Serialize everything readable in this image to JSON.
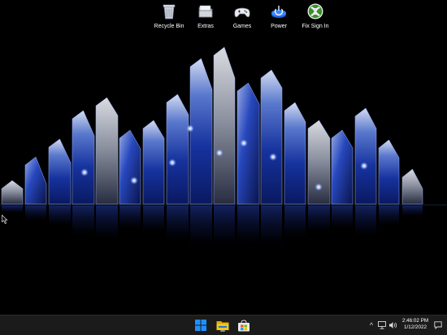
{
  "desktop": {
    "icons": [
      {
        "label": "Recycle Bin",
        "icon": "recycle-bin-icon"
      },
      {
        "label": "Extras",
        "icon": "folder-icon"
      },
      {
        "label": "Games",
        "icon": "gamepad-icon"
      },
      {
        "label": "Power",
        "icon": "power-icon"
      },
      {
        "label": "Fix Sign In",
        "icon": "xbox-icon"
      }
    ],
    "wallpaper": {
      "theme": "blue crystal prisms with reflection",
      "accent": "#1e4fd8"
    }
  },
  "taskbar": {
    "pinned": [
      {
        "name": "start-button",
        "icon": "windows-logo-icon"
      },
      {
        "name": "file-explorer-button",
        "icon": "folder-icon"
      },
      {
        "name": "microsoft-store-button",
        "icon": "store-icon"
      }
    ],
    "tray": {
      "chevron": "^",
      "network_icon": "network-icon",
      "volume_icon": "volume-icon"
    },
    "clock": {
      "time": "2:46:02 PM",
      "date": "1/12/2022"
    },
    "notification_icon": "notification-icon"
  },
  "colors": {
    "taskbar_bg": "#1b1b1b",
    "windows_blue": "#1e90ff",
    "explorer_yellow": "#f5c518",
    "xbox_green": "#3a8f2c"
  }
}
